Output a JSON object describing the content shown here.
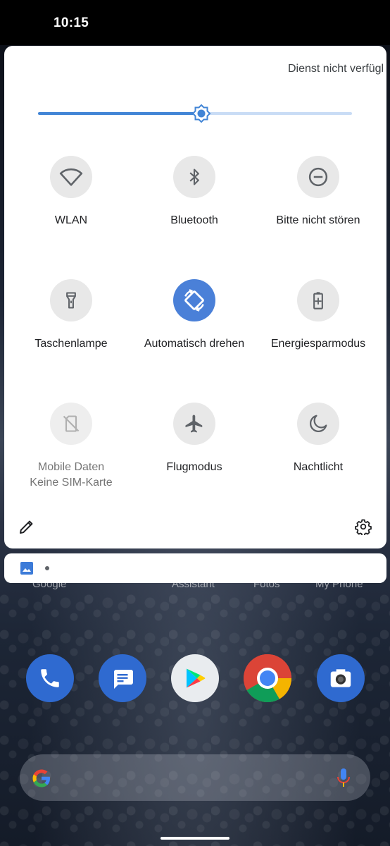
{
  "status_bar": {
    "time": "10:15"
  },
  "quick_settings": {
    "carrier_text": "Dienst nicht verfügbar",
    "brightness_level": 0.52,
    "tiles": [
      {
        "label": "WLAN",
        "icon": "wifi-icon",
        "state": "off"
      },
      {
        "label": "Bluetooth",
        "icon": "bluetooth-icon",
        "state": "off"
      },
      {
        "label": "Bitte nicht stören",
        "icon": "do-not-disturb-icon",
        "state": "off"
      },
      {
        "label": "Taschenlampe",
        "icon": "flashlight-icon",
        "state": "off"
      },
      {
        "label": "Automatisch drehen",
        "icon": "auto-rotate-icon",
        "state": "on"
      },
      {
        "label": "Energiesparmodus",
        "icon": "battery-saver-icon",
        "state": "off"
      },
      {
        "label": "Mobile Daten",
        "sublabel": "Keine SIM-Karte",
        "icon": "no-sim-icon",
        "state": "unavailable"
      },
      {
        "label": "Flugmodus",
        "icon": "airplane-icon",
        "state": "off"
      },
      {
        "label": "Nachtlicht",
        "icon": "moon-icon",
        "state": "off"
      }
    ],
    "edit_icon": "pencil-icon",
    "settings_icon": "gear-icon"
  },
  "notification": {
    "icon": "image-icon"
  },
  "home": {
    "app_labels": [
      "Google",
      "Assistant",
      "Fotos",
      "My Phone"
    ],
    "dock": [
      "phone-icon",
      "messages-icon",
      "play-store-icon",
      "chrome-icon",
      "camera-icon"
    ],
    "search_bar": {
      "icons": [
        "google-g-icon",
        "microphone-icon"
      ]
    }
  },
  "colors": {
    "accent": "#4a80d8",
    "tile_off": "#e8e8e8",
    "panel": "#ffffff"
  }
}
